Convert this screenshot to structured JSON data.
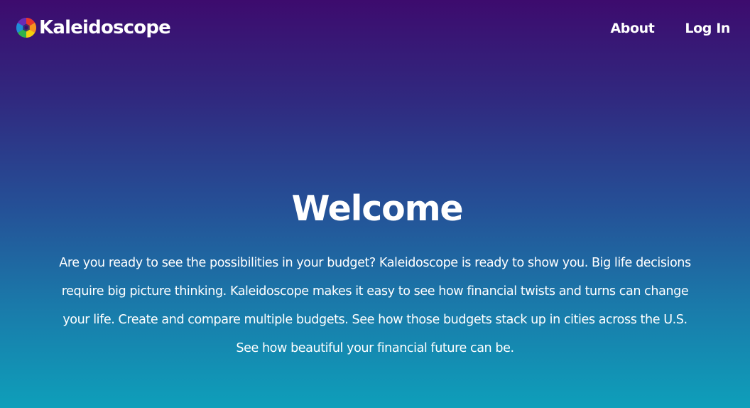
{
  "nav": {
    "brand": {
      "name": "Kaleidoscope",
      "logo_icon": "kaleidoscope-aperture-icon",
      "logo_colors": [
        "#e8352b",
        "#f7931e",
        "#f5d10c",
        "#2fb34a",
        "#1e8ed8",
        "#6a2bb5"
      ]
    },
    "links": {
      "about": "About",
      "login": "Log In"
    }
  },
  "hero": {
    "title": "Welcome",
    "body": "Are you ready to see the possibilities in your budget? Kaleidoscope is ready to show you. Big life decisions require big picture thinking. Kaleidoscope makes it easy to see how financial twists and turns can change your life. Create and compare multiple budgets. See how those budgets stack up in cities across the U.S. See how beautiful your financial future can be."
  },
  "theme": {
    "gradient_top": "#3d0b6e",
    "gradient_bottom": "#0e9fba",
    "text_color": "#ffffff"
  }
}
